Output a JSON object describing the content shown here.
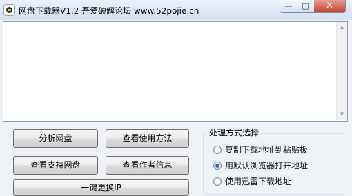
{
  "window": {
    "title": "网盘下载器V1.2    吾爱破解论坛 www.52pojie.cn",
    "minimize_glyph": "—",
    "maximize_glyph": "□",
    "close_glyph": "✕"
  },
  "output": {
    "value": ""
  },
  "buttons": {
    "analyze": "分析网盘",
    "usage": "查看使用方法",
    "supported": "查看支持网盘",
    "author": "查看作者信息",
    "change_ip": "一键更换IP"
  },
  "processing": {
    "legend": "处理方式选择",
    "options": [
      {
        "label": "复制下载地址到粘贴板",
        "checked": false
      },
      {
        "label": "用默认浏览器打开地址",
        "checked": true
      },
      {
        "label": "使用迅雷下载地址",
        "checked": false
      }
    ]
  }
}
